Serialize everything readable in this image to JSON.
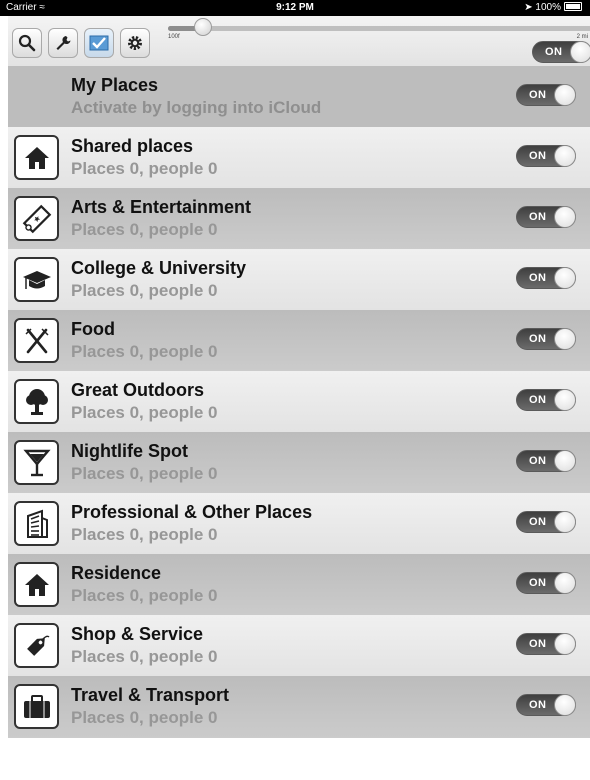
{
  "status_bar": {
    "carrier": "Carrier",
    "time": "9:12 PM",
    "battery": "100%"
  },
  "toolbar": {
    "buttons": [
      {
        "icon": "search-icon"
      },
      {
        "icon": "wrench-icon"
      },
      {
        "icon": "map-check-icon"
      },
      {
        "icon": "gear-icon"
      }
    ],
    "slider": {
      "min_label": "100f",
      "max_label": "2 mi",
      "value_fraction": 0.1
    },
    "master_toggle": "ON"
  },
  "header_row": {
    "title": "My Places",
    "subtitle": "Activate by logging into iCloud",
    "toggle": "ON"
  },
  "categories": [
    {
      "title": "Shared places",
      "subtitle": "Places 0, people 0",
      "icon": "house-icon",
      "toggle": "ON"
    },
    {
      "title": "Arts & Entertainment",
      "subtitle": "Places 0, people 0",
      "icon": "ticket-icon",
      "toggle": "ON"
    },
    {
      "title": "College & University",
      "subtitle": "Places 0, people 0",
      "icon": "graduation-cap-icon",
      "toggle": "ON"
    },
    {
      "title": "Food",
      "subtitle": "Places 0, people 0",
      "icon": "fork-knife-icon",
      "toggle": "ON"
    },
    {
      "title": "Great Outdoors",
      "subtitle": "Places 0, people 0",
      "icon": "tree-icon",
      "toggle": "ON"
    },
    {
      "title": "Nightlife Spot",
      "subtitle": "Places 0, people 0",
      "icon": "cocktail-glass-icon",
      "toggle": "ON"
    },
    {
      "title": "Professional & Other Places",
      "subtitle": "Places 0, people 0",
      "icon": "office-building-icon",
      "toggle": "ON"
    },
    {
      "title": "Residence",
      "subtitle": "Places 0, people 0",
      "icon": "house-icon",
      "toggle": "ON"
    },
    {
      "title": "Shop & Service",
      "subtitle": "Places 0, people 0",
      "icon": "price-tag-icon",
      "toggle": "ON"
    },
    {
      "title": "Travel & Transport",
      "subtitle": "Places 0, people 0",
      "icon": "suitcase-icon",
      "toggle": "ON"
    }
  ]
}
